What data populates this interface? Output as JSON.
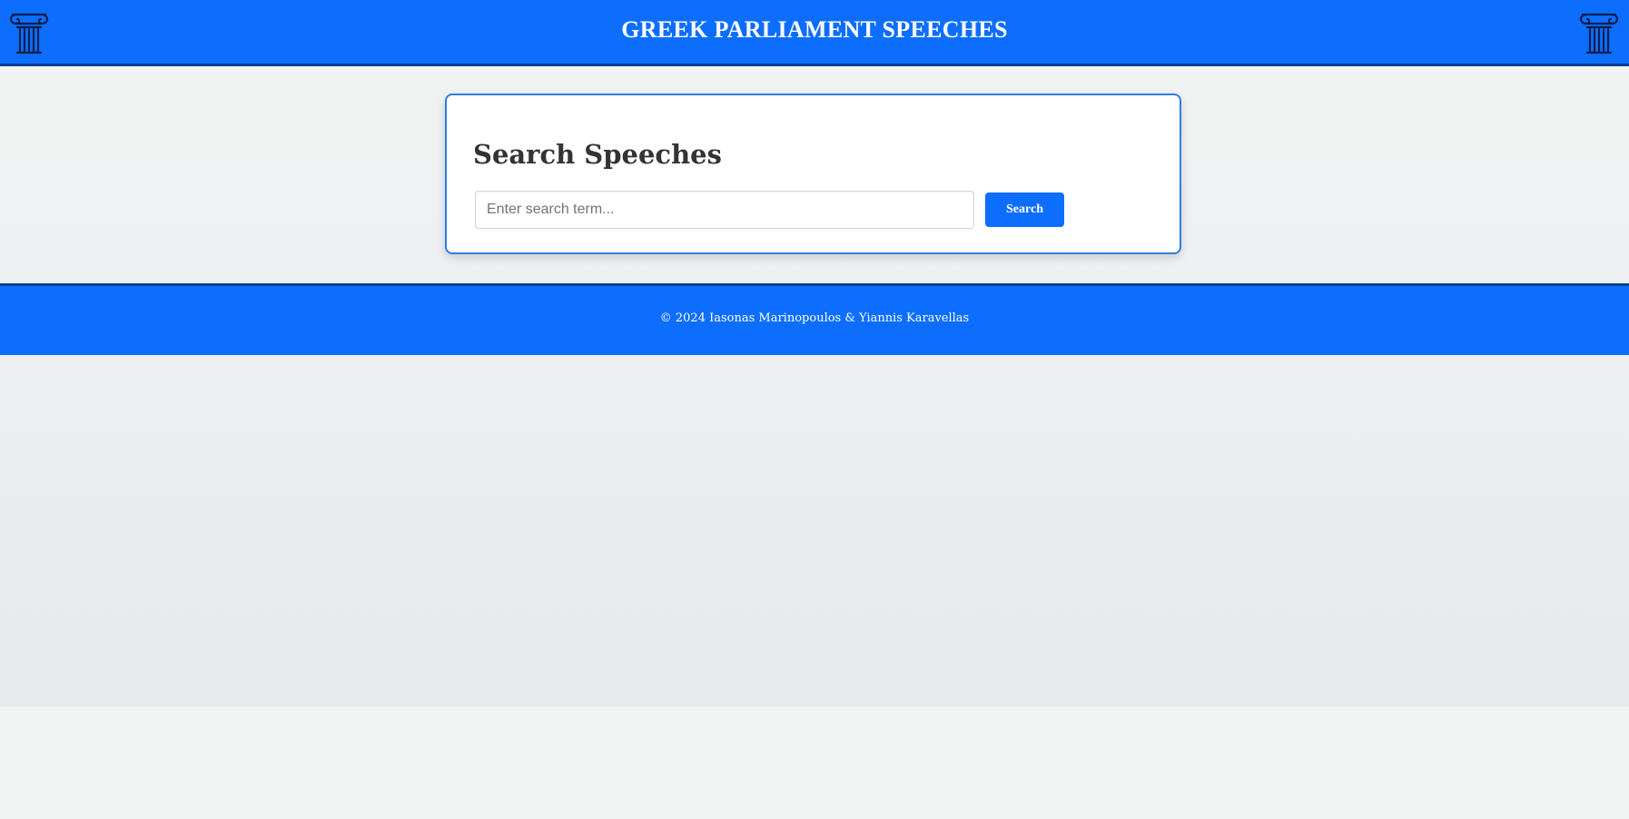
{
  "header": {
    "title": "GREEK PARLIAMENT SPEECHES",
    "left_icon": "ionic-column-icon",
    "right_icon": "ionic-column-icon"
  },
  "search": {
    "heading": "Search Speeches",
    "input_value": "",
    "placeholder": "Enter search term...",
    "button_label": "Search"
  },
  "footer": {
    "text": "© 2024 Iasonas Marinopoulos & Yiannis Karavellas"
  },
  "colors": {
    "primary": "#0d6efd",
    "primary_dark": "#0a3f8f",
    "card_border": "#2f7de1",
    "heading_text": "#333333",
    "background": "#f2f3f3"
  }
}
